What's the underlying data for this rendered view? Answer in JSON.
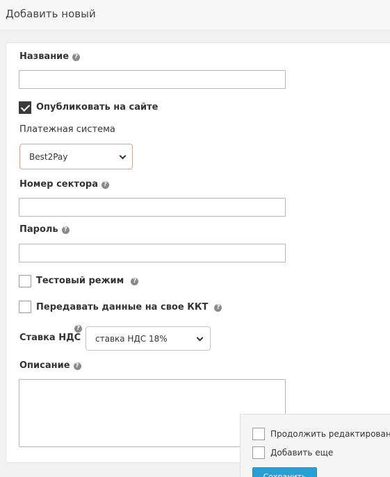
{
  "header": {
    "title": "Добавить новый"
  },
  "form": {
    "name_label": "Название",
    "publish_label": "Опубликовать на сайте",
    "payment_system_label": "Платежная система",
    "payment_system_value": "Best2Pay",
    "sector_label": "Номер сектора",
    "password_label": "Пароль",
    "test_mode_label": "Тестовый режим",
    "kkt_label": "Передавать данные на свое ККТ",
    "vat_label": "Ставка НДС",
    "vat_value": "ставка НДС 18%",
    "description_label": "Описание",
    "help_glyph": "?"
  },
  "bottom": {
    "continue_editing_label": "Продолжить редактирование",
    "add_more_label": "Добавить еще",
    "save_label": "Сохранить"
  }
}
